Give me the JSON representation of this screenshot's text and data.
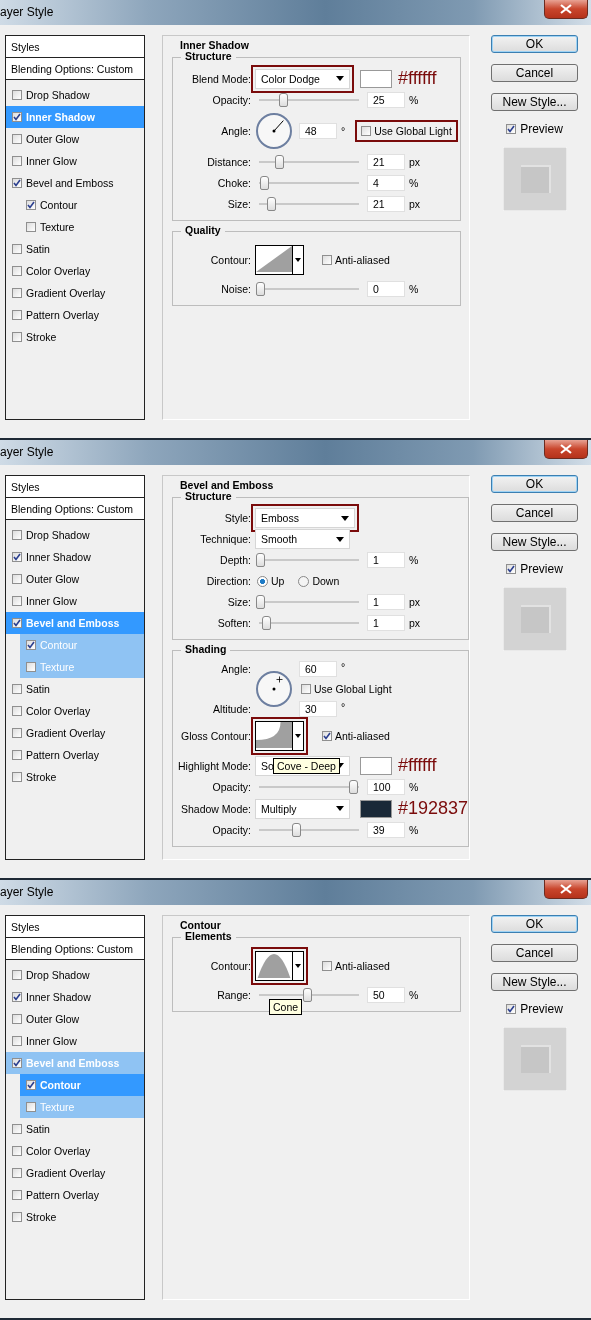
{
  "dialogs": [
    {
      "title": "ayer Style",
      "styles": {
        "header": "Styles",
        "blending": "Blending Options: Custom",
        "items": [
          {
            "label": "Drop Shadow",
            "checked": false,
            "selected": false,
            "highlighted": false
          },
          {
            "label": "Inner Shadow",
            "checked": true,
            "selected": true,
            "highlighted": false
          },
          {
            "label": "Outer Glow",
            "checked": false,
            "selected": false,
            "highlighted": false
          },
          {
            "label": "Inner Glow",
            "checked": false,
            "selected": false,
            "highlighted": false
          },
          {
            "label": "Bevel and Emboss",
            "checked": true,
            "selected": false,
            "highlighted": false,
            "children": [
              {
                "label": "Contour",
                "checked": true,
                "selected": false,
                "highlighted": false
              },
              {
                "label": "Texture",
                "checked": false,
                "selected": false,
                "highlighted": false
              }
            ]
          },
          {
            "label": "Satin",
            "checked": false,
            "selected": false,
            "highlighted": false
          },
          {
            "label": "Color Overlay",
            "checked": false,
            "selected": false,
            "highlighted": false
          },
          {
            "label": "Gradient Overlay",
            "checked": false,
            "selected": false,
            "highlighted": false
          },
          {
            "label": "Pattern Overlay",
            "checked": false,
            "selected": false,
            "highlighted": false
          },
          {
            "label": "Stroke",
            "checked": false,
            "selected": false,
            "highlighted": false
          }
        ]
      },
      "panel": {
        "title": "Inner Shadow",
        "groups": [
          {
            "title": "Structure",
            "rows": [
              {
                "kind": "select",
                "label": "Blend Mode:",
                "value": "Color Dodge",
                "color": "#ffffff",
                "note": "#ffffff",
                "annotated": true
              },
              {
                "kind": "slider",
                "label": "Opacity:",
                "level": 0.25,
                "value": "25",
                "unit": "%"
              },
              {
                "kind": "angle",
                "label": "Angle:",
                "value": "48",
                "unit": "°",
                "option": {
                  "label": "Use Global Light",
                  "checked": false,
                  "annotated": true
                }
              },
              {
                "kind": "slider",
                "label": "Distance:",
                "level": 0.2,
                "value": "21",
                "unit": "px"
              },
              {
                "kind": "slider",
                "label": "Choke:",
                "level": 0.04,
                "value": "4",
                "unit": "%"
              },
              {
                "kind": "slider",
                "label": "Size:",
                "level": 0.12,
                "value": "21",
                "unit": "px"
              }
            ]
          },
          {
            "title": "Quality",
            "rows": [
              {
                "kind": "contour",
                "label": "Contour:",
                "curve": {
                  "kind": "linear"
                },
                "annotated": false,
                "option": {
                  "label": "Anti-aliased",
                  "checked": false
                }
              },
              {
                "kind": "slider",
                "label": "Noise:",
                "level": 0,
                "value": "0",
                "unit": "%"
              }
            ]
          }
        ]
      },
      "buttons": [
        {
          "label": "OK",
          "default": true
        },
        {
          "label": "Cancel",
          "default": false
        },
        {
          "label": "New Style...",
          "default": false
        }
      ],
      "preview": {
        "label": "Preview",
        "checked": true
      }
    },
    {
      "title": "ayer Style",
      "styles": {
        "header": "Styles",
        "blending": "Blending Options: Custom",
        "items": [
          {
            "label": "Drop Shadow",
            "checked": false,
            "selected": false,
            "highlighted": false
          },
          {
            "label": "Inner Shadow",
            "checked": true,
            "selected": false,
            "highlighted": false
          },
          {
            "label": "Outer Glow",
            "checked": false,
            "selected": false,
            "highlighted": false
          },
          {
            "label": "Inner Glow",
            "checked": false,
            "selected": false,
            "highlighted": false
          },
          {
            "label": "Bevel and Emboss",
            "checked": true,
            "selected": true,
            "highlighted": false,
            "children": [
              {
                "label": "Contour",
                "checked": true,
                "selected": false,
                "highlighted": true
              },
              {
                "label": "Texture",
                "checked": false,
                "selected": false,
                "highlighted": true
              }
            ]
          },
          {
            "label": "Satin",
            "checked": false,
            "selected": false,
            "highlighted": false
          },
          {
            "label": "Color Overlay",
            "checked": false,
            "selected": false,
            "highlighted": false
          },
          {
            "label": "Gradient Overlay",
            "checked": false,
            "selected": false,
            "highlighted": false
          },
          {
            "label": "Pattern Overlay",
            "checked": false,
            "selected": false,
            "highlighted": false
          },
          {
            "label": "Stroke",
            "checked": false,
            "selected": false,
            "highlighted": false
          }
        ]
      },
      "panel": {
        "title": "Bevel and Emboss",
        "groups": [
          {
            "title": "Structure",
            "rows": [
              {
                "kind": "select",
                "label": "Style:",
                "value": "Emboss",
                "annotated": true
              },
              {
                "kind": "select",
                "label": "Technique:",
                "value": "Smooth",
                "annotated": false
              },
              {
                "kind": "slider",
                "label": "Depth:",
                "level": 0,
                "value": "1",
                "unit": "%"
              },
              {
                "kind": "radio",
                "label": "Direction:",
                "options": [
                  {
                    "label": "Up",
                    "selected": true
                  },
                  {
                    "label": "Down",
                    "selected": false
                  }
                ]
              },
              {
                "kind": "slider",
                "label": "Size:",
                "level": 0,
                "value": "1",
                "unit": "px"
              },
              {
                "kind": "slider",
                "label": "Soften:",
                "level": 0.06,
                "value": "1",
                "unit": "px"
              }
            ]
          },
          {
            "title": "Shading",
            "rows": [
              {
                "kind": "light",
                "label": "Angle:",
                "value": "60",
                "unit": "°",
                "option": {
                  "label": "Use Global Light",
                  "checked": false,
                  "annotated": false
                },
                "altitude_label": "Altitude:",
                "altitude_value": "30",
                "altitude_unit": "°"
              },
              {
                "kind": "contour",
                "label": "Gloss Contour:",
                "curve": {
                  "kind": "cove"
                },
                "annotated": true,
                "option": {
                  "label": "Anti-aliased",
                  "checked": true
                }
              },
              {
                "kind": "select",
                "label": "Highlight Mode:",
                "value": "So",
                "color": "#ffffff",
                "note": "#ffffff",
                "tooltip": "Cove - Deep",
                "annotated": false
              },
              {
                "kind": "slider",
                "label": "Opacity:",
                "level": 1,
                "value": "100",
                "unit": "%"
              },
              {
                "kind": "select",
                "label": "Shadow Mode:",
                "value": "Multiply",
                "color": "#192837",
                "note": "#192837",
                "annotated": false
              },
              {
                "kind": "slider",
                "label": "Opacity:",
                "level": 0.39,
                "value": "39",
                "unit": "%"
              }
            ]
          }
        ]
      },
      "buttons": [
        {
          "label": "OK",
          "default": true
        },
        {
          "label": "Cancel",
          "default": false
        },
        {
          "label": "New Style...",
          "default": false
        }
      ],
      "preview": {
        "label": "Preview",
        "checked": true
      }
    },
    {
      "title": "ayer Style",
      "styles": {
        "header": "Styles",
        "blending": "Blending Options: Custom",
        "items": [
          {
            "label": "Drop Shadow",
            "checked": false,
            "selected": false,
            "highlighted": false
          },
          {
            "label": "Inner Shadow",
            "checked": true,
            "selected": false,
            "highlighted": false
          },
          {
            "label": "Outer Glow",
            "checked": false,
            "selected": false,
            "highlighted": false
          },
          {
            "label": "Inner Glow",
            "checked": false,
            "selected": false,
            "highlighted": false
          },
          {
            "label": "Bevel and Emboss",
            "checked": true,
            "selected": false,
            "highlighted": true,
            "children": [
              {
                "label": "Contour",
                "checked": true,
                "selected": true,
                "highlighted": false
              },
              {
                "label": "Texture",
                "checked": false,
                "selected": false,
                "highlighted": true
              }
            ]
          },
          {
            "label": "Satin",
            "checked": false,
            "selected": false,
            "highlighted": false
          },
          {
            "label": "Color Overlay",
            "checked": false,
            "selected": false,
            "highlighted": false
          },
          {
            "label": "Gradient Overlay",
            "checked": false,
            "selected": false,
            "highlighted": false
          },
          {
            "label": "Pattern Overlay",
            "checked": false,
            "selected": false,
            "highlighted": false
          },
          {
            "label": "Stroke",
            "checked": false,
            "selected": false,
            "highlighted": false
          }
        ]
      },
      "panel": {
        "title": "Contour",
        "groups": [
          {
            "title": "Elements",
            "rows": [
              {
                "kind": "contour",
                "label": "Contour:",
                "curve": {
                  "kind": "cone"
                },
                "annotated": true,
                "option": {
                  "label": "Anti-aliased",
                  "checked": false
                }
              },
              {
                "kind": "slider",
                "label": "Range:",
                "level": 0.5,
                "value": "50",
                "unit": "%",
                "tooltip": "Cone"
              }
            ]
          }
        ]
      },
      "buttons": [
        {
          "label": "OK",
          "default": true
        },
        {
          "label": "Cancel",
          "default": false
        },
        {
          "label": "New Style...",
          "default": false
        }
      ],
      "preview": {
        "label": "Preview",
        "checked": true
      }
    }
  ]
}
